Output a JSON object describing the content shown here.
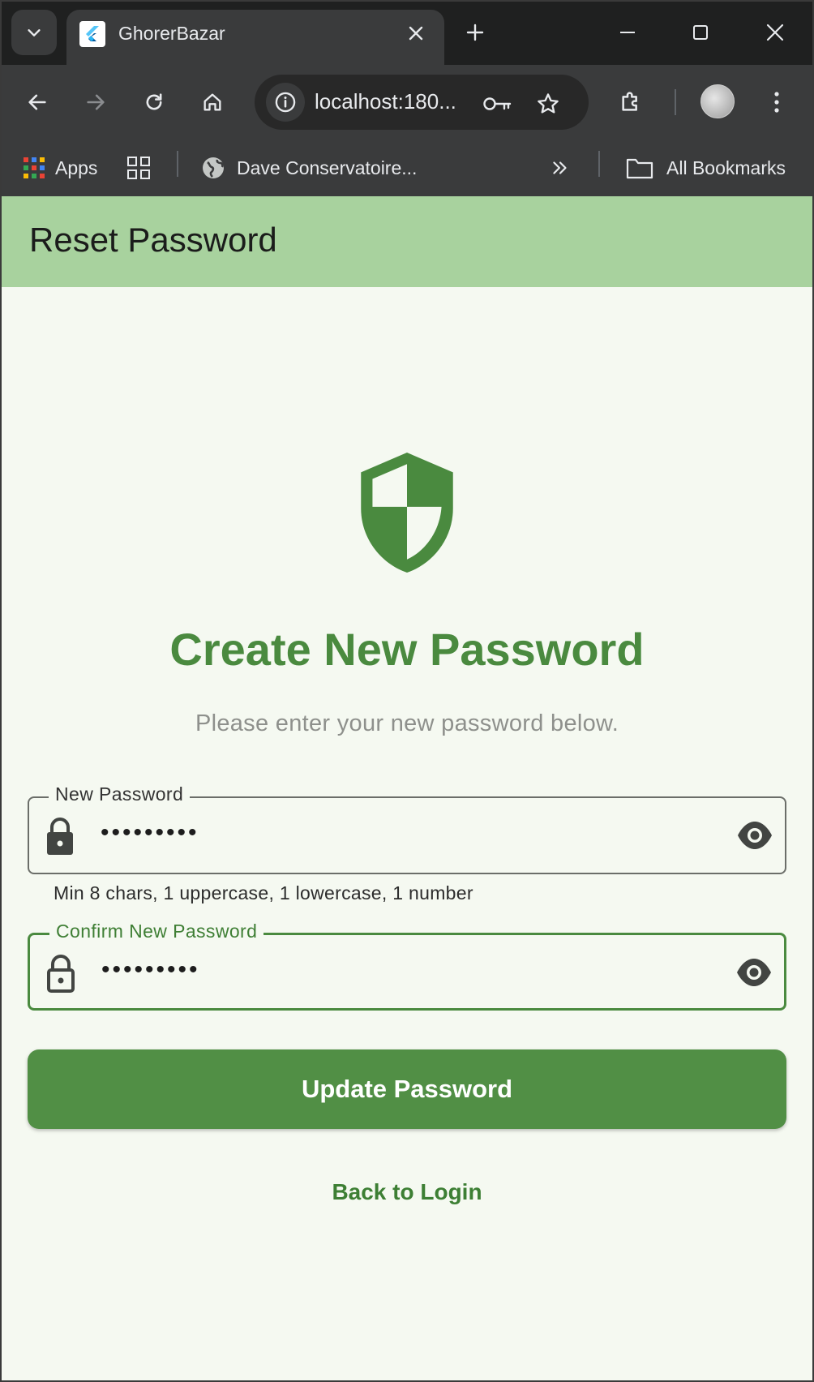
{
  "browser": {
    "tab_title": "GhorerBazar",
    "url": "localhost:180...",
    "bookmarks": {
      "apps_label": "Apps",
      "site_label": "Dave Conservatoire...",
      "all_bookmarks_label": "All Bookmarks"
    }
  },
  "appbar": {
    "title": "Reset Password"
  },
  "main": {
    "heading": "Create New Password",
    "subtitle": "Please enter your new password below.",
    "new_password": {
      "label": "New Password",
      "value": "•••••••••",
      "helper": "Min 8 chars, 1 uppercase, 1 lowercase, 1 number"
    },
    "confirm_password": {
      "label": "Confirm New Password",
      "value": "•••••••••"
    },
    "update_button_label": "Update Password",
    "back_link_label": "Back to Login"
  },
  "colors": {
    "appbar": "#a8d29e",
    "primary": "#518f45",
    "page_background": "#f5f9f1"
  },
  "icons": [
    "tab-search-icon",
    "flutter-favicon-icon",
    "close-icon",
    "plus-icon",
    "minimize-icon",
    "maximize-icon",
    "back-icon",
    "forward-icon",
    "reload-icon",
    "home-icon",
    "info-icon",
    "key-icon",
    "star-icon",
    "extensions-icon",
    "more-icon",
    "apps-grid-icon",
    "tab-groups-icon",
    "globe-icon",
    "chevron-double-right-icon",
    "folder-icon",
    "shield-icon",
    "lock-icon",
    "eye-icon"
  ]
}
